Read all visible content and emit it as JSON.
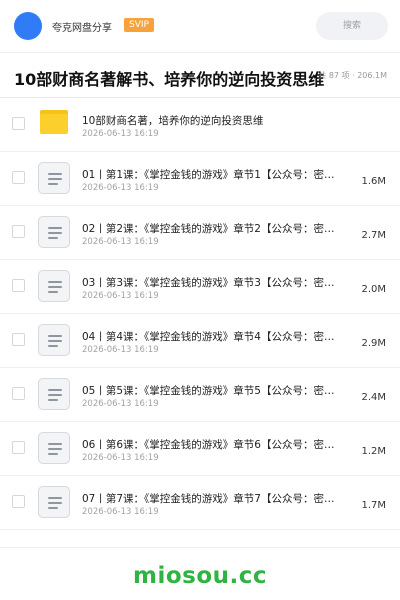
{
  "header": {
    "app_name": "夸克网盘分享",
    "badge": "SVIP",
    "search_placeholder": "搜索"
  },
  "title": {
    "text": "10部财商名著解书、培养你的逆向投资思维",
    "meta": "共 87 项 · 206.1M"
  },
  "folder": {
    "name": "10部财商名著，培养你的逆向投资思维",
    "date": "2026-06-13 16:19",
    "icon": "folder-icon"
  },
  "files": [
    {
      "name": "01丨第1课：《掌控金钱的游戏》章节1【公众号：密…",
      "date": "2026-06-13 16:19",
      "size": "1.6M"
    },
    {
      "name": "02丨第2课：《掌控金钱的游戏》章节2【公众号：密…",
      "date": "2026-06-13 16:19",
      "size": "2.7M"
    },
    {
      "name": "03丨第3课：《掌控金钱的游戏》章节3【公众号：密…",
      "date": "2026-06-13 16:19",
      "size": "2.0M"
    },
    {
      "name": "04丨第4课：《掌控金钱的游戏》章节4【公众号：密…",
      "date": "2026-06-13 16:19",
      "size": "2.9M"
    },
    {
      "name": "05丨第5课：《掌控金钱的游戏》章节5【公众号：密…",
      "date": "2026-06-13 16:19",
      "size": "2.4M"
    },
    {
      "name": "06丨第6课：《掌控金钱的游戏》章节6【公众号：密…",
      "date": "2026-06-13 16:19",
      "size": "1.2M"
    },
    {
      "name": "07丨第7课：《掌控金钱的游戏》章节7【公众号：密…",
      "date": "2026-06-13 16:19",
      "size": "1.7M"
    }
  ],
  "watermark": "miosou.cc",
  "colors": {
    "avatar": "#2f7cf6",
    "badge": "#f7a23b",
    "folder": "#fbcf2c",
    "watermark": "#2fb342"
  }
}
